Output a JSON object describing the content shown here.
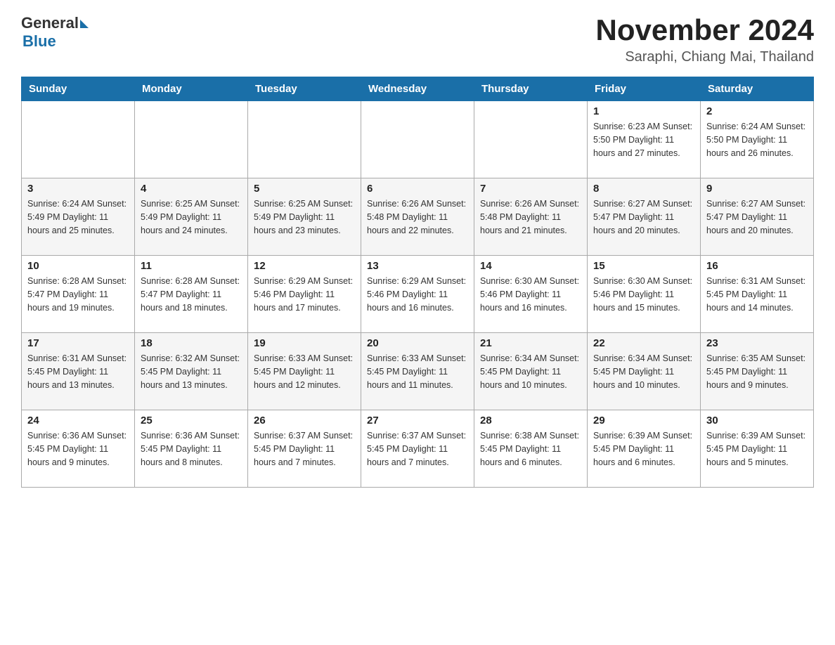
{
  "header": {
    "logo_general": "General",
    "logo_blue": "Blue",
    "month_year": "November 2024",
    "location": "Saraphi, Chiang Mai, Thailand"
  },
  "weekdays": [
    "Sunday",
    "Monday",
    "Tuesday",
    "Wednesday",
    "Thursday",
    "Friday",
    "Saturday"
  ],
  "rows": [
    [
      {
        "day": "",
        "info": ""
      },
      {
        "day": "",
        "info": ""
      },
      {
        "day": "",
        "info": ""
      },
      {
        "day": "",
        "info": ""
      },
      {
        "day": "",
        "info": ""
      },
      {
        "day": "1",
        "info": "Sunrise: 6:23 AM\nSunset: 5:50 PM\nDaylight: 11 hours and 27 minutes."
      },
      {
        "day": "2",
        "info": "Sunrise: 6:24 AM\nSunset: 5:50 PM\nDaylight: 11 hours and 26 minutes."
      }
    ],
    [
      {
        "day": "3",
        "info": "Sunrise: 6:24 AM\nSunset: 5:49 PM\nDaylight: 11 hours and 25 minutes."
      },
      {
        "day": "4",
        "info": "Sunrise: 6:25 AM\nSunset: 5:49 PM\nDaylight: 11 hours and 24 minutes."
      },
      {
        "day": "5",
        "info": "Sunrise: 6:25 AM\nSunset: 5:49 PM\nDaylight: 11 hours and 23 minutes."
      },
      {
        "day": "6",
        "info": "Sunrise: 6:26 AM\nSunset: 5:48 PM\nDaylight: 11 hours and 22 minutes."
      },
      {
        "day": "7",
        "info": "Sunrise: 6:26 AM\nSunset: 5:48 PM\nDaylight: 11 hours and 21 minutes."
      },
      {
        "day": "8",
        "info": "Sunrise: 6:27 AM\nSunset: 5:47 PM\nDaylight: 11 hours and 20 minutes."
      },
      {
        "day": "9",
        "info": "Sunrise: 6:27 AM\nSunset: 5:47 PM\nDaylight: 11 hours and 20 minutes."
      }
    ],
    [
      {
        "day": "10",
        "info": "Sunrise: 6:28 AM\nSunset: 5:47 PM\nDaylight: 11 hours and 19 minutes."
      },
      {
        "day": "11",
        "info": "Sunrise: 6:28 AM\nSunset: 5:47 PM\nDaylight: 11 hours and 18 minutes."
      },
      {
        "day": "12",
        "info": "Sunrise: 6:29 AM\nSunset: 5:46 PM\nDaylight: 11 hours and 17 minutes."
      },
      {
        "day": "13",
        "info": "Sunrise: 6:29 AM\nSunset: 5:46 PM\nDaylight: 11 hours and 16 minutes."
      },
      {
        "day": "14",
        "info": "Sunrise: 6:30 AM\nSunset: 5:46 PM\nDaylight: 11 hours and 16 minutes."
      },
      {
        "day": "15",
        "info": "Sunrise: 6:30 AM\nSunset: 5:46 PM\nDaylight: 11 hours and 15 minutes."
      },
      {
        "day": "16",
        "info": "Sunrise: 6:31 AM\nSunset: 5:45 PM\nDaylight: 11 hours and 14 minutes."
      }
    ],
    [
      {
        "day": "17",
        "info": "Sunrise: 6:31 AM\nSunset: 5:45 PM\nDaylight: 11 hours and 13 minutes."
      },
      {
        "day": "18",
        "info": "Sunrise: 6:32 AM\nSunset: 5:45 PM\nDaylight: 11 hours and 13 minutes."
      },
      {
        "day": "19",
        "info": "Sunrise: 6:33 AM\nSunset: 5:45 PM\nDaylight: 11 hours and 12 minutes."
      },
      {
        "day": "20",
        "info": "Sunrise: 6:33 AM\nSunset: 5:45 PM\nDaylight: 11 hours and 11 minutes."
      },
      {
        "day": "21",
        "info": "Sunrise: 6:34 AM\nSunset: 5:45 PM\nDaylight: 11 hours and 10 minutes."
      },
      {
        "day": "22",
        "info": "Sunrise: 6:34 AM\nSunset: 5:45 PM\nDaylight: 11 hours and 10 minutes."
      },
      {
        "day": "23",
        "info": "Sunrise: 6:35 AM\nSunset: 5:45 PM\nDaylight: 11 hours and 9 minutes."
      }
    ],
    [
      {
        "day": "24",
        "info": "Sunrise: 6:36 AM\nSunset: 5:45 PM\nDaylight: 11 hours and 9 minutes."
      },
      {
        "day": "25",
        "info": "Sunrise: 6:36 AM\nSunset: 5:45 PM\nDaylight: 11 hours and 8 minutes."
      },
      {
        "day": "26",
        "info": "Sunrise: 6:37 AM\nSunset: 5:45 PM\nDaylight: 11 hours and 7 minutes."
      },
      {
        "day": "27",
        "info": "Sunrise: 6:37 AM\nSunset: 5:45 PM\nDaylight: 11 hours and 7 minutes."
      },
      {
        "day": "28",
        "info": "Sunrise: 6:38 AM\nSunset: 5:45 PM\nDaylight: 11 hours and 6 minutes."
      },
      {
        "day": "29",
        "info": "Sunrise: 6:39 AM\nSunset: 5:45 PM\nDaylight: 11 hours and 6 minutes."
      },
      {
        "day": "30",
        "info": "Sunrise: 6:39 AM\nSunset: 5:45 PM\nDaylight: 11 hours and 5 minutes."
      }
    ]
  ]
}
